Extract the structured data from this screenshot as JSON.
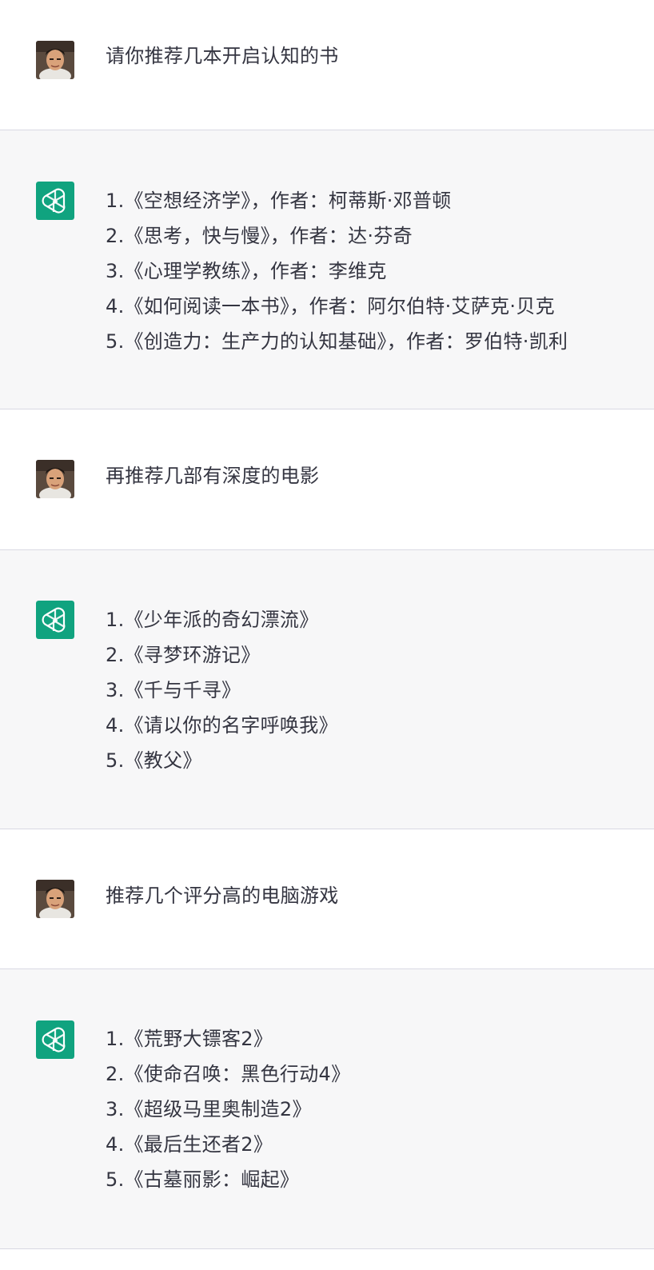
{
  "conversation": {
    "turns": [
      {
        "role": "user",
        "avatar_icon": "user-photo-avatar",
        "text": "请你推荐几本开启认知的书"
      },
      {
        "role": "assistant",
        "avatar_icon": "openai-logo-icon",
        "items": [
          "1.《空想经济学》，作者：柯蒂斯·邓普顿",
          "2.《思考，快与慢》，作者：达·芬奇",
          "3.《心理学教练》，作者：李维克",
          "4.《如何阅读一本书》，作者：阿尔伯特·艾萨克·贝克",
          "5.《创造力：生产力的认知基础》，作者：罗伯特·凯利"
        ]
      },
      {
        "role": "user",
        "avatar_icon": "user-photo-avatar",
        "text": "再推荐几部有深度的电影"
      },
      {
        "role": "assistant",
        "avatar_icon": "openai-logo-icon",
        "items": [
          "1.《少年派的奇幻漂流》",
          "2.《寻梦环游记》",
          "3.《千与千寻》",
          "4.《请以你的名字呼唤我》",
          "5.《教父》"
        ]
      },
      {
        "role": "user",
        "avatar_icon": "user-photo-avatar",
        "text": "推荐几个评分高的电脑游戏"
      },
      {
        "role": "assistant",
        "avatar_icon": "openai-logo-icon",
        "items": [
          "1.《荒野大镖客2》",
          "2.《使命召唤：黑色行动4》",
          "3.《超级马里奥制造2》",
          "4.《最后生还者2》",
          "5.《古墓丽影：崛起》"
        ]
      }
    ]
  },
  "colors": {
    "assistant_bg": "#f7f7f8",
    "user_bg": "#ffffff",
    "openai_green": "#10a37f",
    "text": "#343541",
    "divider": "#d9d9e3"
  }
}
